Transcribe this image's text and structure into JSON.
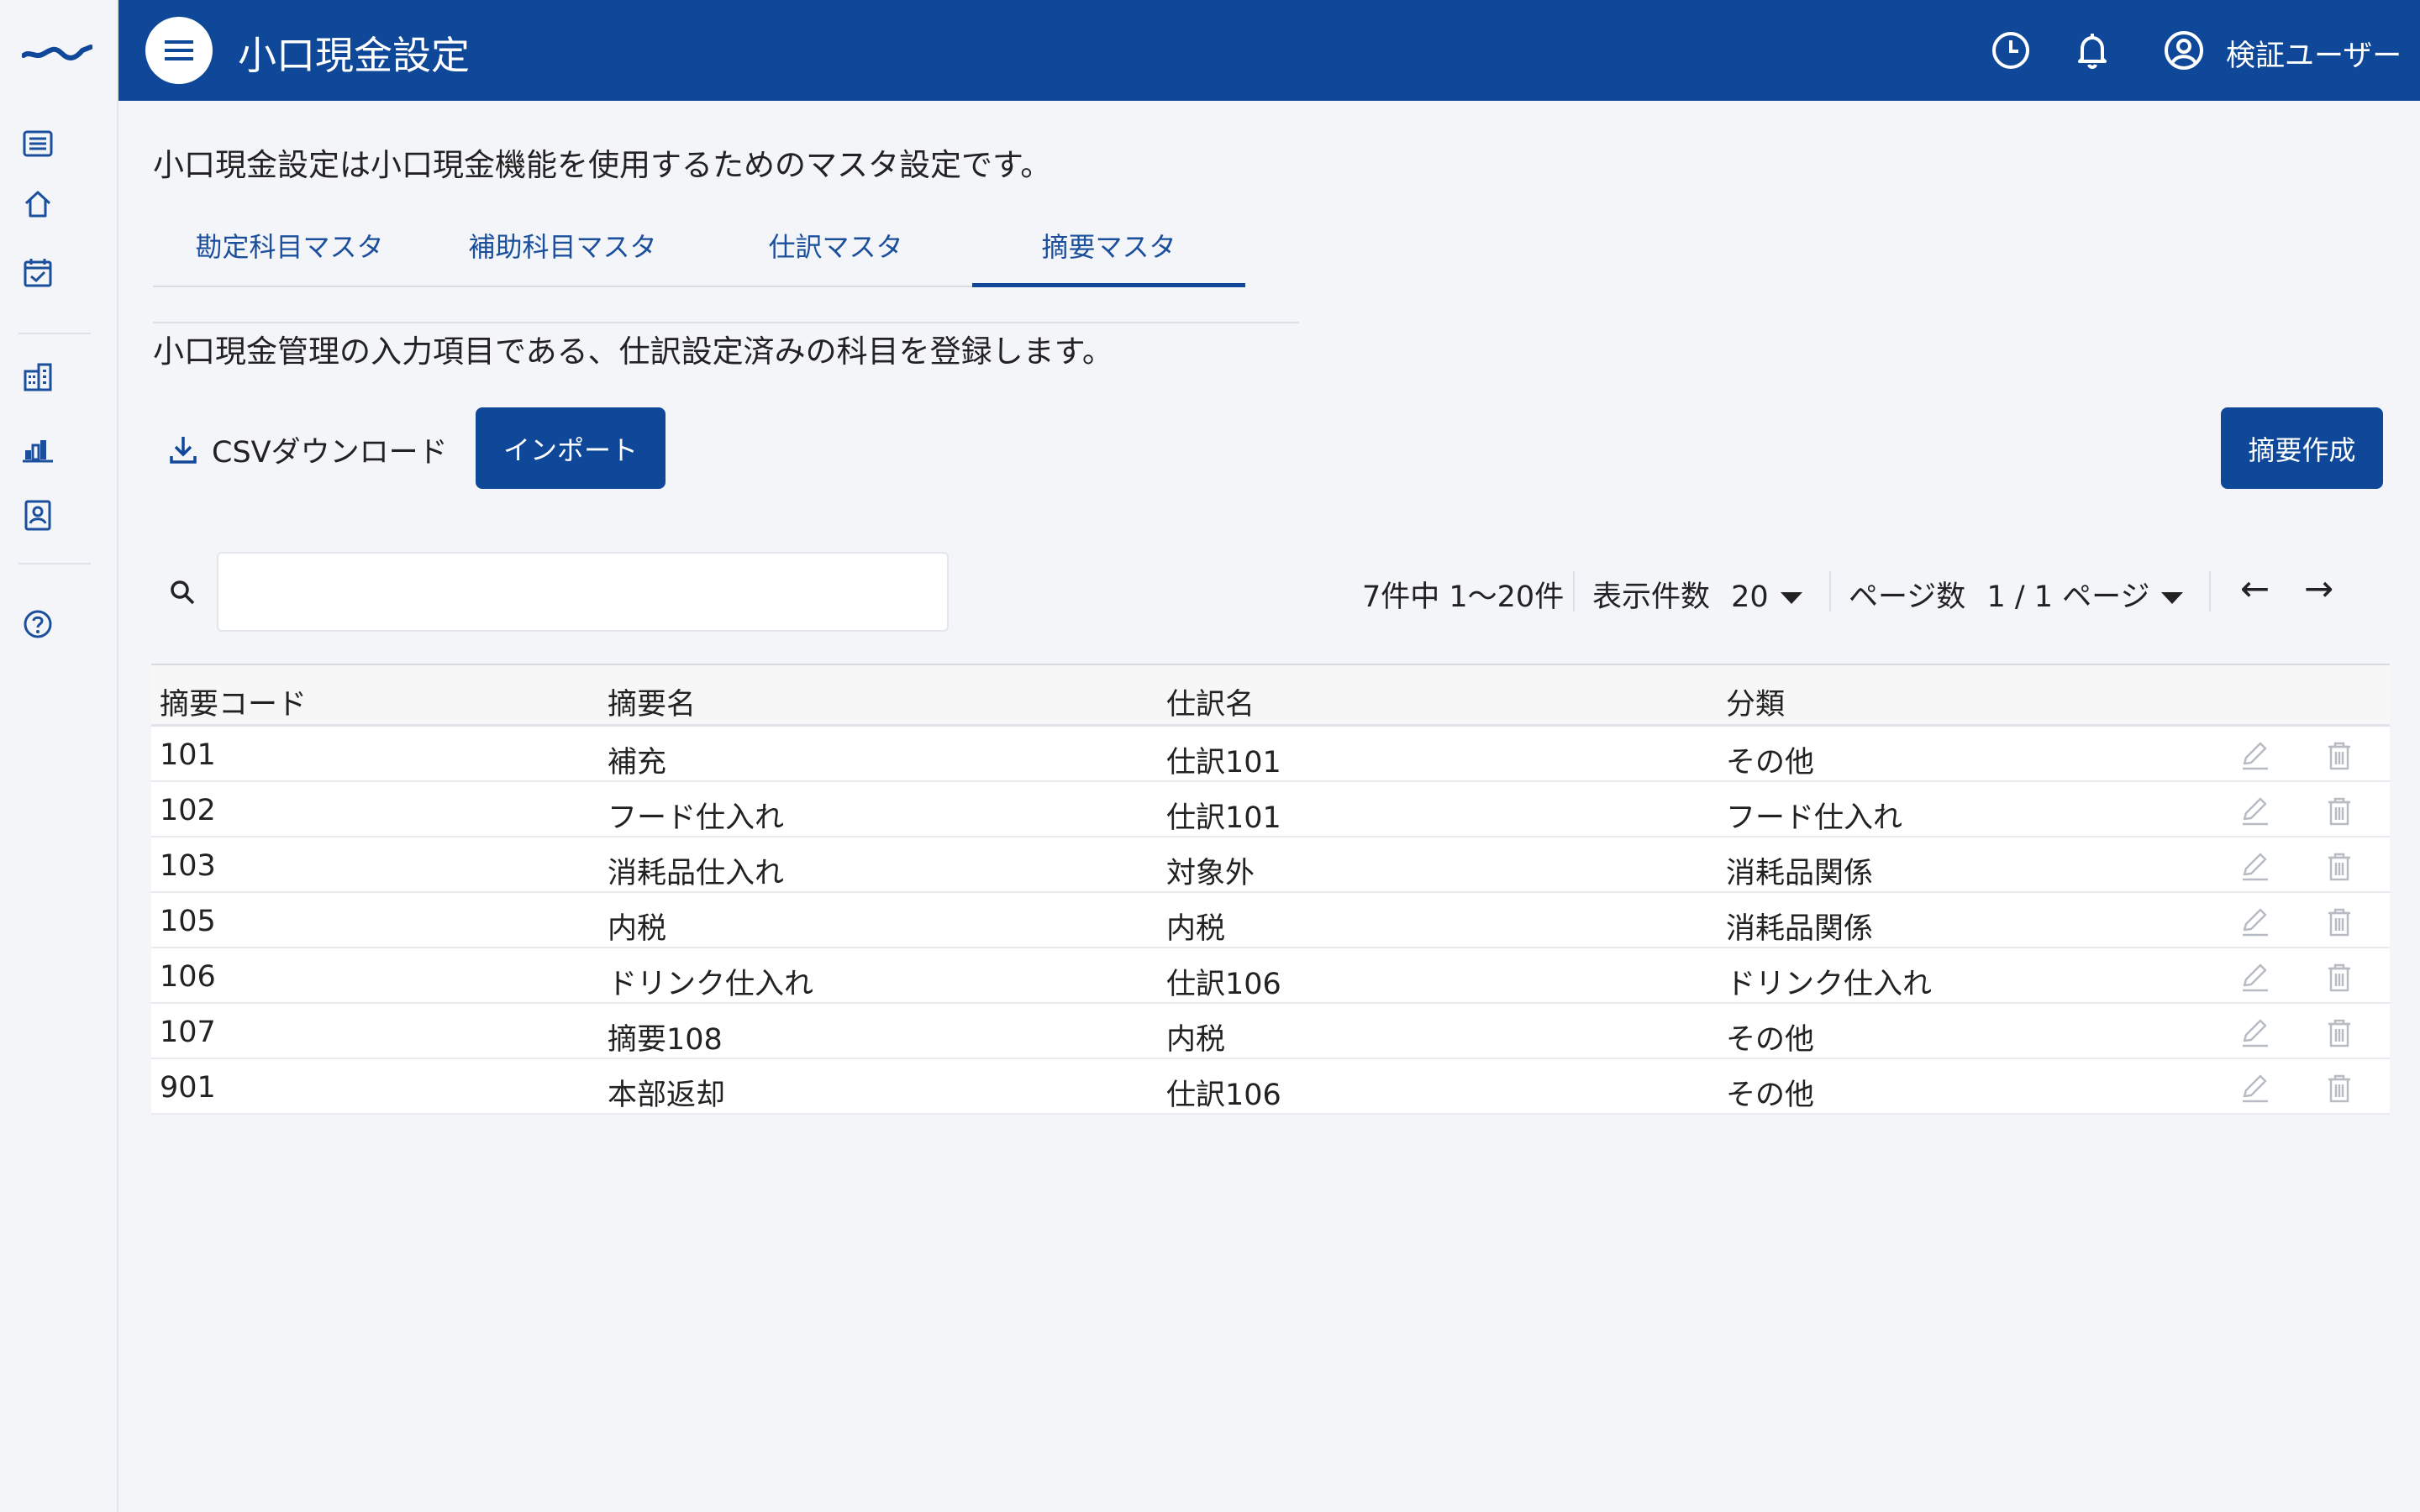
{
  "app": {
    "title": "小口現金設定",
    "user_name": "検証ユーザー",
    "brand_color": "#0f4799"
  },
  "sidebar": {
    "icons": [
      "list-icon",
      "home-icon",
      "calendar-check-icon",
      "building-icon",
      "bar-chart-icon",
      "contact-badge-icon",
      "help-icon"
    ]
  },
  "page": {
    "intro": "小口現金設定は小口現金機能を使用するためのマスタ設定です。",
    "tabs": [
      {
        "label": "勘定科目マスタ",
        "active": false
      },
      {
        "label": "補助科目マスタ",
        "active": false
      },
      {
        "label": "仕訳マスタ",
        "active": false
      },
      {
        "label": "摘要マスタ",
        "active": true
      }
    ],
    "section_desc": "小口現金管理の入力項目である、仕訳設定済みの科目を登録します。"
  },
  "toolbar": {
    "csv_label": "CSVダウンロード",
    "import_label": "インポート",
    "create_label": "摘要作成"
  },
  "search": {
    "placeholder": "",
    "value": ""
  },
  "pagination": {
    "summary": "7件中 1〜20件",
    "per_page_label": "表示件数",
    "per_page_value": "20",
    "page_label": "ページ数",
    "page_value": "1 / 1 ページ",
    "prev": "←",
    "next": "→"
  },
  "table": {
    "headers": [
      "摘要コード",
      "摘要名",
      "仕訳名",
      "分類"
    ],
    "rows": [
      [
        "101",
        "補充",
        "仕訳101",
        "その他"
      ],
      [
        "102",
        "フード仕入れ",
        "仕訳101",
        "フード仕入れ"
      ],
      [
        "103",
        "消耗品仕入れ",
        "対象外",
        "消耗品関係"
      ],
      [
        "105",
        "内税",
        "内税",
        "消耗品関係"
      ],
      [
        "106",
        "ドリンク仕入れ",
        "仕訳106",
        "ドリンク仕入れ"
      ],
      [
        "107",
        "摘要108",
        "内税",
        "その他"
      ],
      [
        "901",
        "本部返却",
        "仕訳106",
        "その他"
      ]
    ]
  }
}
